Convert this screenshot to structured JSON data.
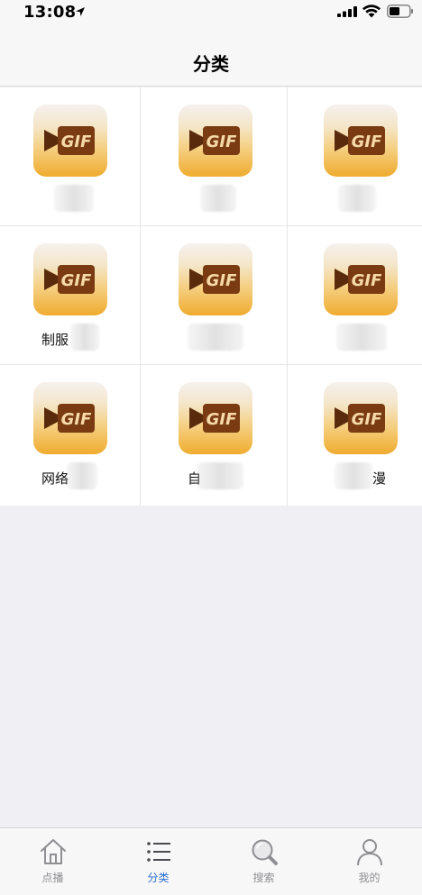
{
  "status_bar": {
    "time": "13:08"
  },
  "nav": {
    "title": "分类"
  },
  "categories": [
    {
      "label": ""
    },
    {
      "label": ""
    },
    {
      "label": ""
    },
    {
      "label": "制服"
    },
    {
      "label": ""
    },
    {
      "label": ""
    },
    {
      "label": "网络"
    },
    {
      "label": "自"
    },
    {
      "label": "漫"
    }
  ],
  "icon_text": "GIF",
  "tabs": [
    {
      "label": "点播",
      "icon": "home-icon"
    },
    {
      "label": "分类",
      "icon": "list-icon",
      "active": true
    },
    {
      "label": "搜索",
      "icon": "search-icon"
    },
    {
      "label": "我的",
      "icon": "profile-icon"
    }
  ],
  "colors": {
    "accent": "#2a6fd8",
    "tab_inactive": "#8e8e93",
    "icon_gold": "#efac2e",
    "icon_brown": "#7a3b12"
  }
}
